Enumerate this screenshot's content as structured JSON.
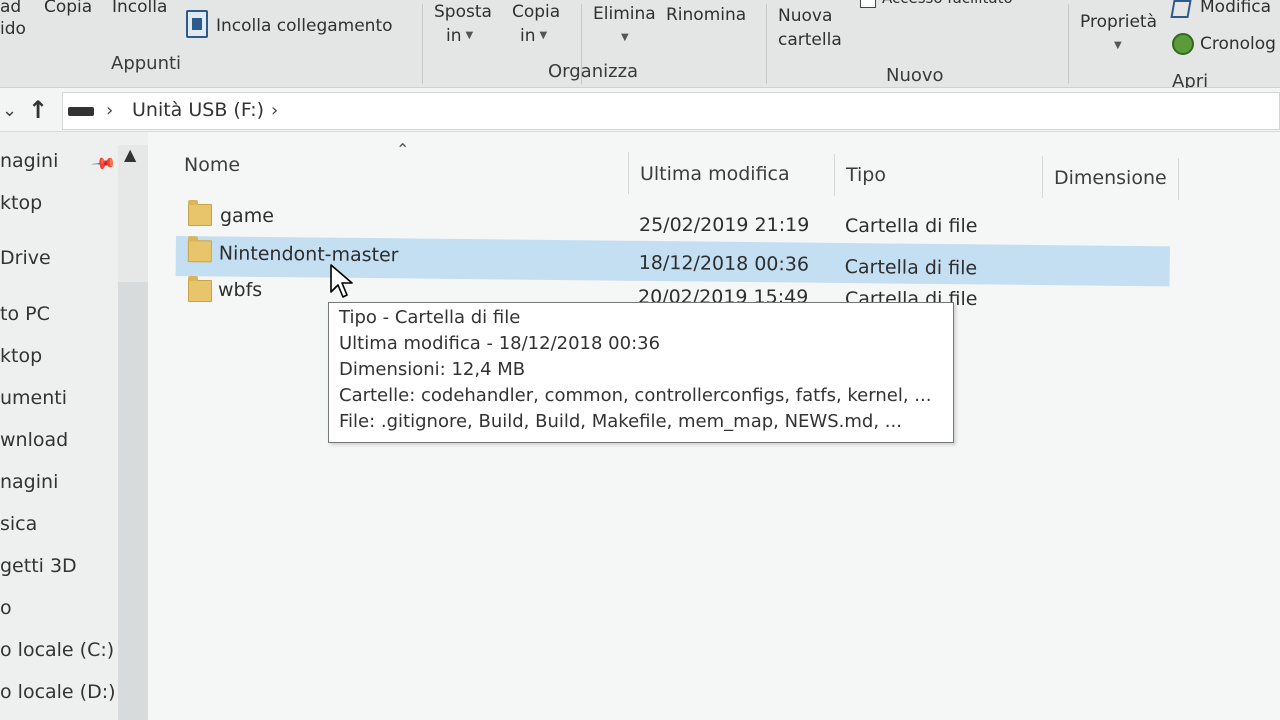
{
  "ribbon": {
    "buttons": {
      "ad_ido": "ad\nido",
      "copy": "Copia",
      "paste": "Incolla",
      "paste_link": "Incolla collegamento",
      "move_to_1": "Sposta",
      "move_to_2": "in",
      "copy_to_1": "Copia",
      "copy_to_2": "in",
      "delete": "Elimina",
      "rename": "Rinomina",
      "new_folder_1": "Nuova",
      "new_folder_2": "cartella",
      "easy_access": "Accesso facilitato",
      "properties": "Proprietà",
      "edit": "Modifica",
      "history": "Cronolog"
    },
    "groups": {
      "clipboard": "Appunti",
      "organize": "Organizza",
      "new": "Nuovo",
      "open": "Apri"
    }
  },
  "address": {
    "location": "Unità USB (F:)"
  },
  "nav": {
    "items": [
      "nagini",
      "ktop",
      "Drive",
      "to PC",
      "ktop",
      "umenti",
      "wnload",
      "nagini",
      "sica",
      "getti 3D",
      "o",
      "o locale (C:)",
      "o locale (D:)"
    ]
  },
  "columns": {
    "name": "Nome",
    "modified": "Ultima modifica",
    "type": "Tipo",
    "size": "Dimensione"
  },
  "files": [
    {
      "name": "game",
      "modified": "25/02/2019 21:19",
      "type": "Cartella di file"
    },
    {
      "name": "Nintendont-master",
      "modified": "18/12/2018 00:36",
      "type": "Cartella di file"
    },
    {
      "name": "wbfs",
      "modified": "20/02/2019 15:49",
      "type": "Cartella di file"
    }
  ],
  "tooltip": {
    "line1": "Tipo - Cartella di file",
    "line2": "Ultima modifica - 18/12/2018 00:36",
    "line3": "Dimensioni: 12,4 MB",
    "line4": "Cartelle: codehandler, common, controllerconfigs, fatfs, kernel, ...",
    "line5": "File: .gitignore, Build, Build, Makefile, mem_map, NEWS.md, ..."
  },
  "colors": {
    "selection": "#c4dff2",
    "folder": "#e8c56b"
  }
}
